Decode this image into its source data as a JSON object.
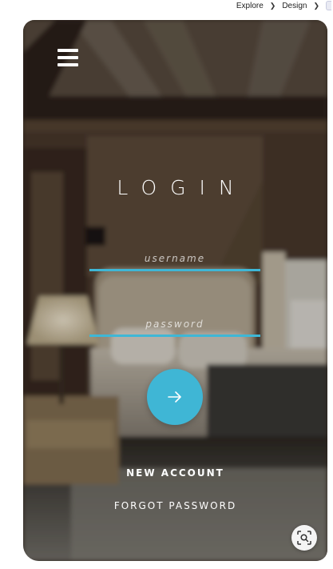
{
  "breadcrumb": {
    "items": [
      "Explore",
      "Design"
    ]
  },
  "login": {
    "title": "LOGIN",
    "username_placeholder": "username",
    "password_placeholder": "password",
    "new_account": "NEW ACCOUNT",
    "forgot_password": "FORGOT PASSWORD"
  },
  "icons": {
    "menu": "hamburger-menu-icon",
    "submit": "arrow-right-icon",
    "visual_search": "visual-search-icon",
    "breadcrumb_separator": "chevron-right-icon"
  },
  "colors": {
    "accent": "#3fb6d5",
    "text": "#ffffff"
  }
}
